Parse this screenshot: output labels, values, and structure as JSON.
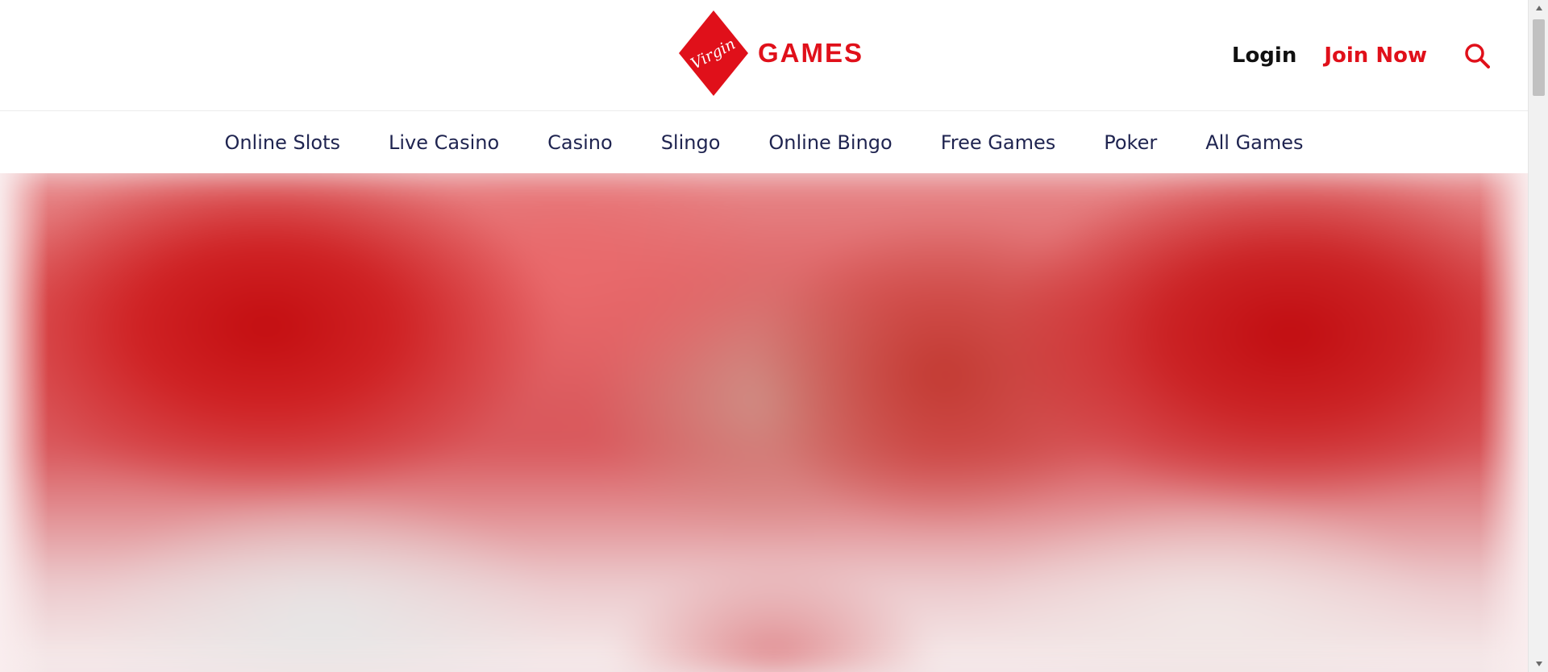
{
  "header": {
    "logo": {
      "script_text": "Virgin",
      "wordmark": "GAMES",
      "icon": "virgin-diamond-logo"
    },
    "auth": {
      "login_label": "Login",
      "join_label": "Join Now"
    },
    "search_icon": "search-icon"
  },
  "nav": {
    "items": [
      {
        "label": "Online Slots"
      },
      {
        "label": "Live Casino"
      },
      {
        "label": "Casino"
      },
      {
        "label": "Slingo"
      },
      {
        "label": "Online Bingo"
      },
      {
        "label": "Free Games"
      },
      {
        "label": "Poker"
      },
      {
        "label": "All Games"
      }
    ]
  },
  "hero": {
    "state": "blurred-banner-image"
  },
  "colors": {
    "brand_red": "#e0101a",
    "nav_text": "#1f2450",
    "login_text": "#111111"
  },
  "scrollbar": {
    "up_icon": "scroll-up-arrow-icon",
    "down_icon": "scroll-down-arrow-icon"
  }
}
